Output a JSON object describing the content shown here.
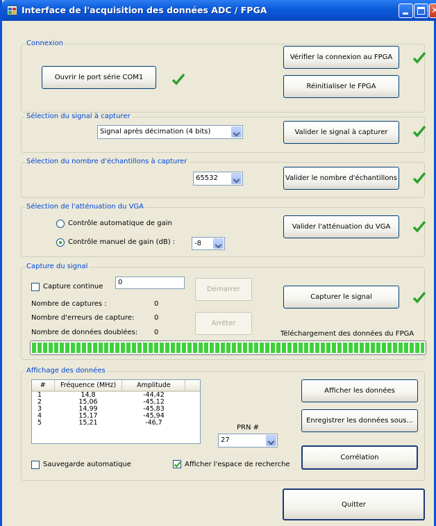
{
  "window": {
    "title": "Interface de l'acquisition des données ADC / FPGA"
  },
  "colors": {
    "accent": "#0046d5",
    "check": "#2fa12f",
    "titlebar": "#0a5ad9"
  },
  "connexion": {
    "label": "Connexion",
    "open_port": "Ouvrir le port série COM1",
    "verify_fpga": "Vérifier la connexion au FPGA",
    "reset_fpga": "Réinitialiser le FPGA"
  },
  "signal": {
    "label": "Sélection du signal à capturer",
    "selected": "Signal après décimation (4 bits)",
    "validate": "Valider le signal à capturer"
  },
  "samples": {
    "label": "Sélection du nombre d'échantillons à capturer",
    "selected": "65532",
    "validate": "Valider le nombre d'échantillons"
  },
  "vga": {
    "label": "Sélection de l'atténuation du VGA",
    "auto": "Contrôle automatique de gain",
    "manual": "Contrôle manuel de gain (dB) :",
    "manual_selected": true,
    "gain": "-8",
    "validate": "Valider l'atténuation du VGA"
  },
  "capture": {
    "label": "Capture du signal",
    "continuous": "Capture continue",
    "continuous_checked": false,
    "count_input": "0",
    "start": "Démarrer",
    "stop": "Arrêter",
    "capture_btn": "Capturer le signal",
    "stats": [
      {
        "label": "Nombre de captures :",
        "value": "0"
      },
      {
        "label": "Nombre d'erreurs de capture:",
        "value": "0"
      },
      {
        "label": "Nombre de données doublées:",
        "value": "0"
      }
    ],
    "download_label": "Téléchargement des données du FPGA",
    "progress": 1.0
  },
  "display": {
    "label": "Affichage des données",
    "columns": [
      "#",
      "Fréquence (MHz)",
      "Amplitude"
    ],
    "rows": [
      [
        "1",
        "14,8",
        "-44,42"
      ],
      [
        "2",
        "15,06",
        "-45,12"
      ],
      [
        "3",
        "14,99",
        "-45,83"
      ],
      [
        "4",
        "15,17",
        "-45,94"
      ],
      [
        "5",
        "15,21",
        "-46,7"
      ]
    ],
    "prn_label": "PRN #",
    "prn_value": "27",
    "show_data": "Afficher les données",
    "save_data": "Enregistrer les données sous...",
    "correlation": "Corrélation",
    "auto_save": "Sauvegarde automatique",
    "auto_save_checked": false,
    "show_search": "Afficher l'espace de recherche",
    "show_search_checked": true
  },
  "quit": "Quitter"
}
